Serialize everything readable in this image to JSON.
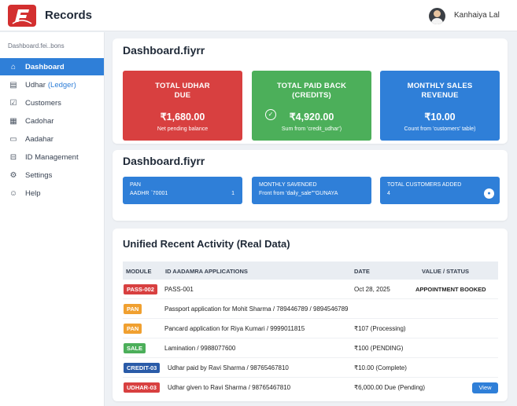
{
  "header": {
    "title": "Records",
    "user": "Kanhaiya Lal"
  },
  "sidebar": {
    "breadcrumb": "Dashboard.fei..bons",
    "items": [
      {
        "label": "Dashboard",
        "icon": "home-icon"
      },
      {
        "label": "Udhar",
        "sub": "(Ledger)",
        "icon": "ledger-icon"
      },
      {
        "label": "Customers",
        "icon": "customers-icon"
      },
      {
        "label": "Cadohar",
        "icon": "cadohar-icon"
      },
      {
        "label": "Aadahar",
        "icon": "id-card-icon"
      },
      {
        "label": "ID Management",
        "icon": "id-management-icon"
      },
      {
        "label": "Settings",
        "icon": "gear-icon"
      },
      {
        "label": "Help",
        "icon": "help-icon"
      }
    ]
  },
  "summary": {
    "title": "Dashboard.fiyrr",
    "cards": [
      {
        "title": "TOTAL UDHAR DUE",
        "value": "₹1,680.00",
        "sub": "Net pending balance",
        "color": "#d84040"
      },
      {
        "title": "TOTAL PAID BACK (CREDITS)",
        "value": "₹4,920.00",
        "sub": "Sum from 'credit_udhar')",
        "color": "#4caf5a"
      },
      {
        "title": "MONTHLY SALES REVENUE",
        "value": "₹10.00",
        "sub": "Count from 'customers' table)",
        "color": "#2f7fd8"
      }
    ]
  },
  "secondary": {
    "title": "Dashboard.fiyrr",
    "cards": [
      {
        "l1": "PAN",
        "l2": "AADHR ˊ70001",
        "r": "1"
      },
      {
        "l1": "MONTHLY SAVENDED",
        "l2": "Front from 'daily_sale'\"'GUNAYA"
      },
      {
        "l1": "TOTAL CUSTOMERS ADDED",
        "l2": "4"
      }
    ]
  },
  "activity": {
    "title": "Unified Recent Activity (Real Data)",
    "columns": [
      "MODULE",
      "ID AADAMRA APPLICATIONS",
      "DATE",
      "VALUE / STATUS"
    ],
    "rows": [
      {
        "module": "PASS-002",
        "badge_color": "#d84040",
        "desc": "PASS-001",
        "date": "Oct 28, 2025",
        "status": "APPOINTMENT BOOKED"
      },
      {
        "module": "PAN",
        "badge_color": "#f0a030",
        "desc": "Passport application for Mohit Sharma / 789446789 / 9894546789",
        "date": "",
        "status": ""
      },
      {
        "module": "PAN",
        "badge_color": "#f0a030",
        "desc": "Pancard application for Riya Kumari / 9999011815",
        "date": "₹107 (Processing)",
        "status": ""
      },
      {
        "module": "SALE",
        "badge_color": "#4caf5a",
        "desc": "Lamination / 9988077600",
        "date": "₹100 (PENDING)",
        "status": ""
      },
      {
        "module": "CREDIT-03",
        "badge_color": "#2a5ba8",
        "desc": "Udhar paid by Ravi Sharma / 98765467810",
        "date": "₹10.00 (Complete)",
        "status": ""
      },
      {
        "module": "UDHAR-03",
        "badge_color": "#d84040",
        "desc": "Udhar given to Ravi Sharma / 98765467810",
        "date": "₹6,000.00 Due (Pending)",
        "status": "",
        "action": "View"
      }
    ]
  }
}
